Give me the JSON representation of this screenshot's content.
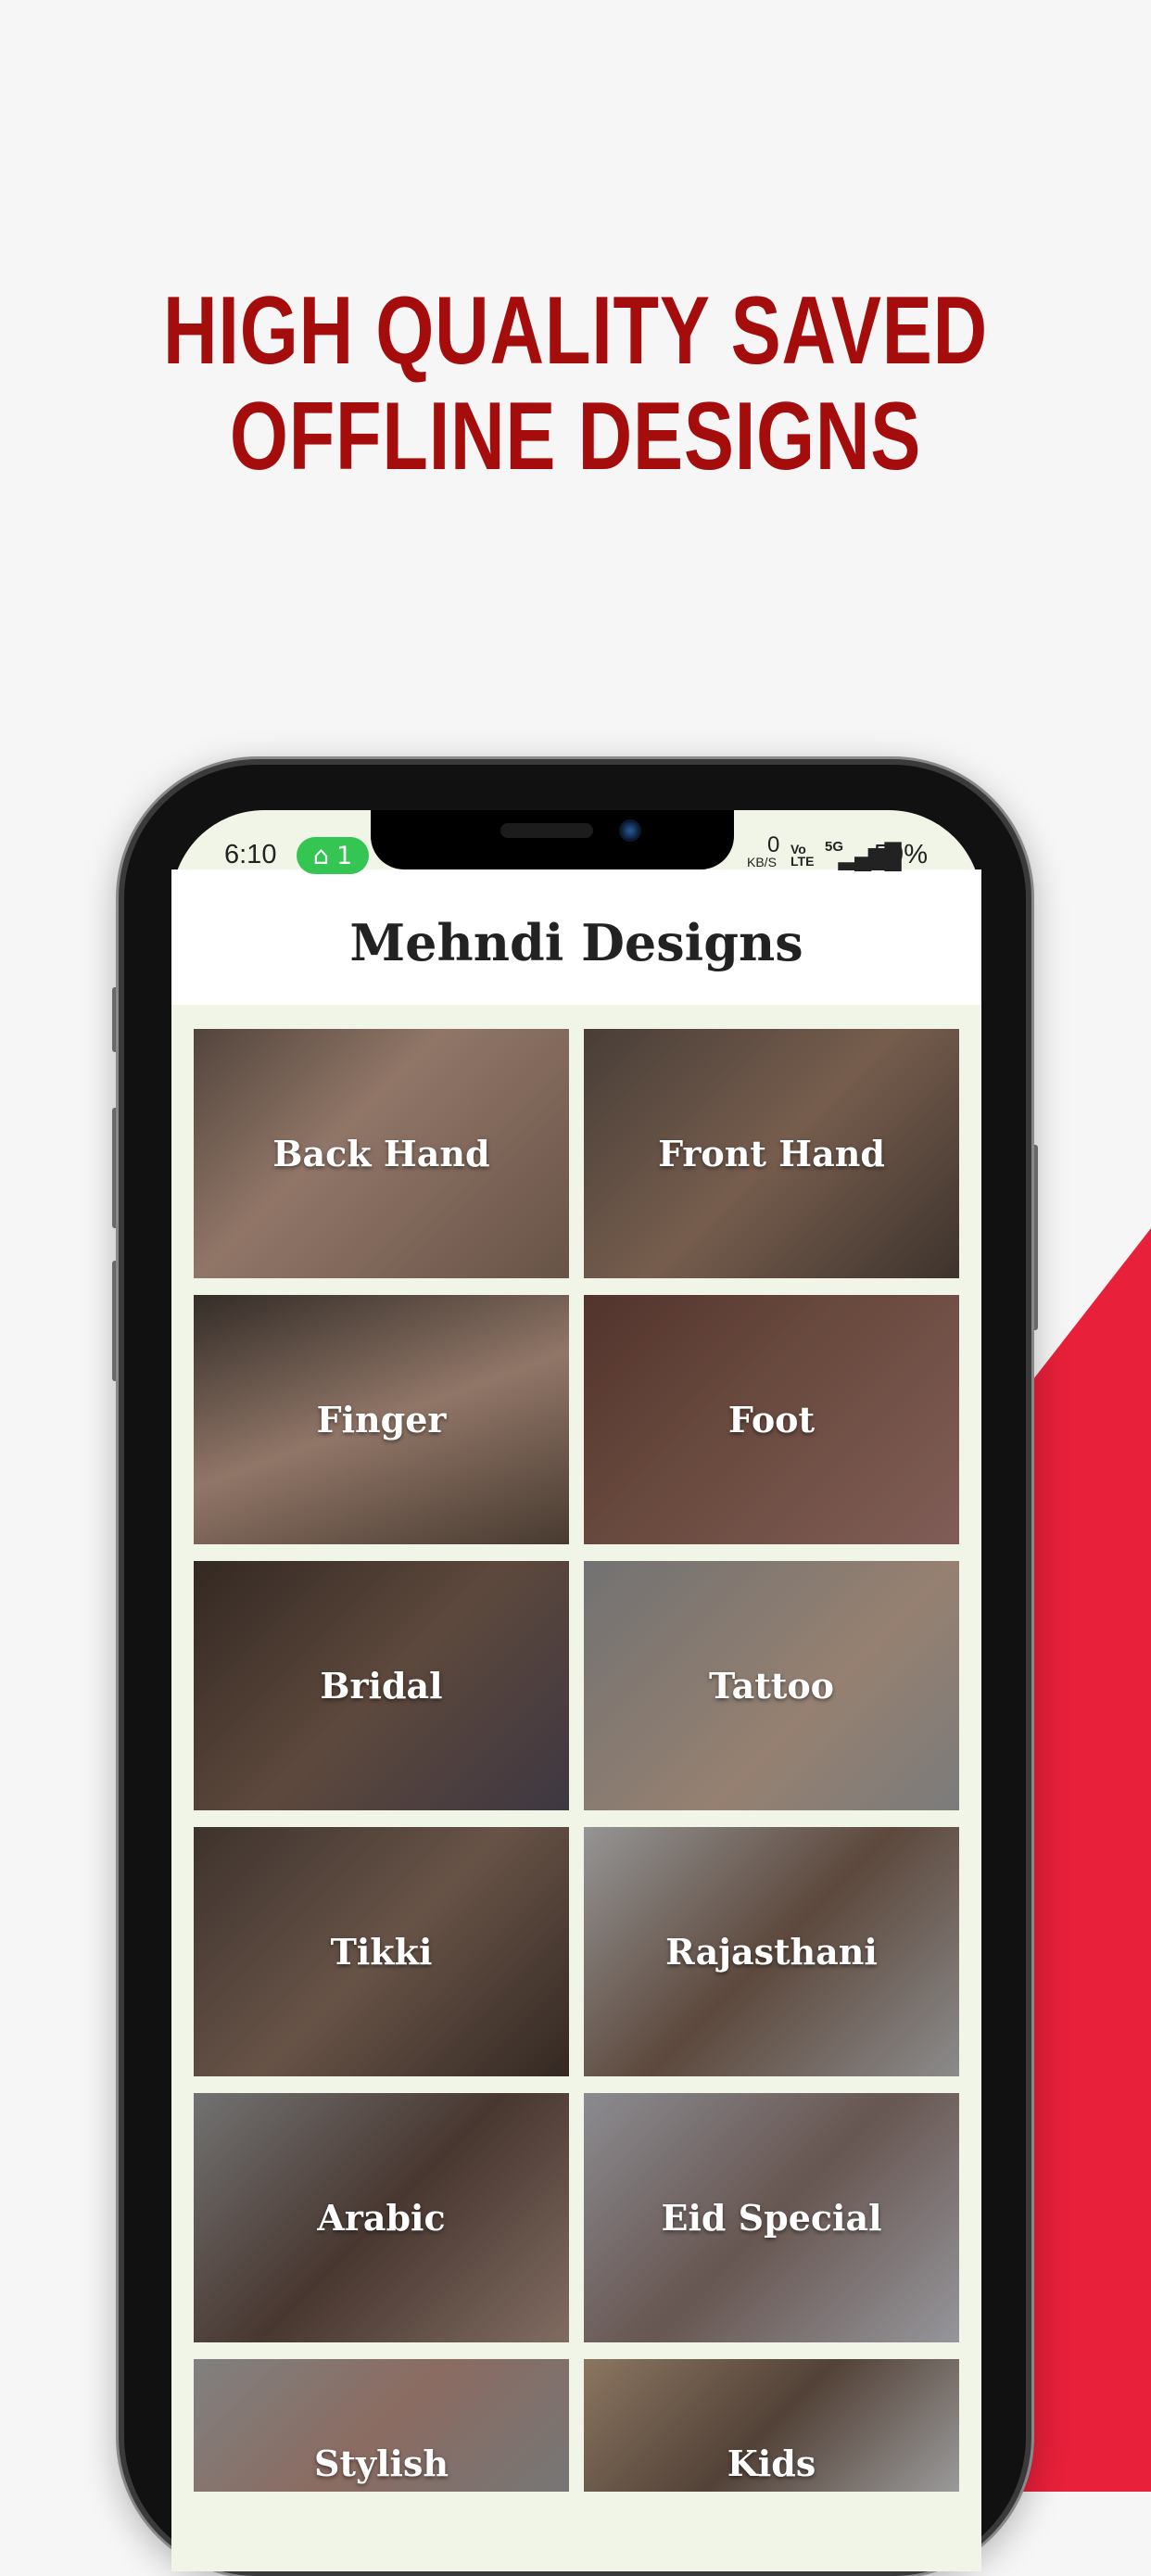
{
  "headline": {
    "line1": "HIGH QUALITY SAVED",
    "line2": "OFFLINE DESIGNS"
  },
  "colors": {
    "headline": "#a50c0c",
    "accent_red": "#e8203a",
    "status_pill": "#34c553"
  },
  "status_bar": {
    "time": "6:10",
    "hotspot_count": "1",
    "network_speed": "0",
    "speed_unit": "KB/S",
    "volte": "Vo LTE",
    "network": "5G",
    "battery": "59%"
  },
  "app": {
    "title": "Mehndi Designs"
  },
  "categories": [
    {
      "label": "Back Hand"
    },
    {
      "label": "Front Hand"
    },
    {
      "label": "Finger"
    },
    {
      "label": "Foot"
    },
    {
      "label": "Bridal"
    },
    {
      "label": "Tattoo"
    },
    {
      "label": "Tikki"
    },
    {
      "label": "Rajasthani"
    },
    {
      "label": "Arabic"
    },
    {
      "label": "Eid Special"
    },
    {
      "label": "Stylish"
    },
    {
      "label": "Kids"
    }
  ]
}
